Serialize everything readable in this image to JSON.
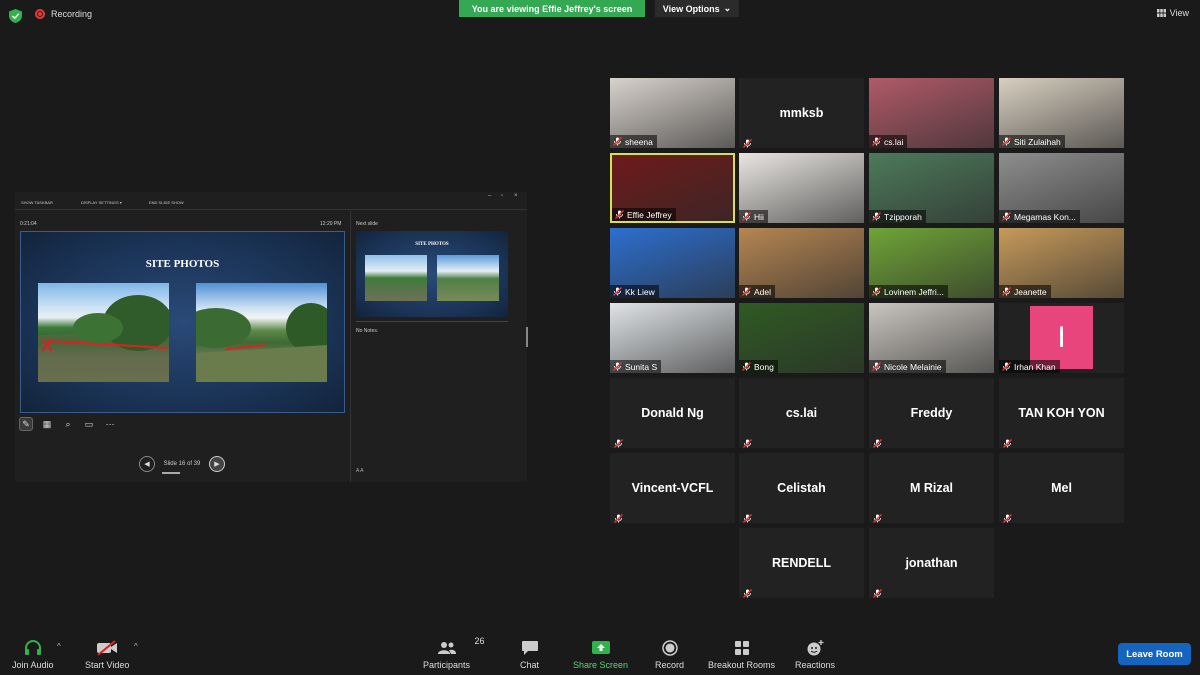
{
  "topbar": {
    "recording": "Recording",
    "viewing_banner": "You are viewing Effie Jeffrey's screen",
    "view_options": "View Options",
    "view": "View"
  },
  "presentation": {
    "toolbar": {
      "taskbar": "SHOW TASKBAR",
      "display": "DISPLAY SETTINGS ▾",
      "end": "END SLIDE SHOW"
    },
    "timer": "0:21:04",
    "clock": "12:20 PM",
    "slide_title": "SITE PHOTOS",
    "slide_counter": "Slide 16 of 39",
    "next_label": "Next slide",
    "next_title": "SITE PHOTOS",
    "notes": "No Notes.",
    "font_controls": "A  A"
  },
  "participants": [
    {
      "name": "sheena",
      "video": true,
      "color": "#d8d2cc"
    },
    {
      "name": "mmksb",
      "video": false
    },
    {
      "name": "cs.lai",
      "video": true,
      "color": "#b05a68"
    },
    {
      "name": "Siti Zulaihah",
      "video": true,
      "color": "#d8cfc0"
    },
    {
      "name": "Effie Jeffrey",
      "video": true,
      "color": "#6e1a1a",
      "active": true
    },
    {
      "name": "Hii",
      "video": true,
      "color": "#e9e6e2"
    },
    {
      "name": "Tzipporah",
      "video": true,
      "color": "#4d7a5a"
    },
    {
      "name": "Megamas Kon...",
      "video": true,
      "color": "#8e8e8e"
    },
    {
      "name": "Kk Liew",
      "video": true,
      "color": "#2d6fcf"
    },
    {
      "name": "Adel",
      "video": true,
      "color": "#b58652"
    },
    {
      "name": "Lovinem Jeffri...",
      "video": true,
      "color": "#6fa437"
    },
    {
      "name": "Jeanette",
      "video": true,
      "color": "#c69a5a"
    },
    {
      "name": "Sunita S",
      "video": true,
      "color": "#dfe3e6"
    },
    {
      "name": "Bong",
      "video": true,
      "color": "#2f5a23"
    },
    {
      "name": "Nicole Melainie",
      "video": true,
      "color": "#c9c5bf"
    },
    {
      "name": "Irhan Khan",
      "video": false,
      "avatar": "I",
      "avatar_color": "#e8457c"
    },
    {
      "name": "Donald Ng",
      "video": false
    },
    {
      "name": "cs.lai",
      "video": false
    },
    {
      "name": "Freddy",
      "video": false
    },
    {
      "name": "TAN KOH YON",
      "video": false
    },
    {
      "name": "Vincent-VCFL",
      "video": false
    },
    {
      "name": "Celistah",
      "video": false
    },
    {
      "name": "M Rizal",
      "video": false
    },
    {
      "name": "Mel",
      "video": false
    },
    {
      "name": "RENDELL",
      "video": false
    },
    {
      "name": "jonathan",
      "video": false
    }
  ],
  "toolbar": {
    "join_audio": "Join Audio",
    "start_video": "Start Video",
    "participants": "Participants",
    "participants_count": "26",
    "chat": "Chat",
    "share_screen": "Share Screen",
    "record": "Record",
    "breakout_rooms": "Breakout Rooms",
    "reactions": "Reactions",
    "leave_room": "Leave Room"
  }
}
